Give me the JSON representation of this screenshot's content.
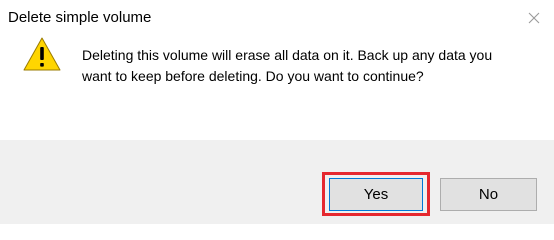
{
  "window": {
    "title": "Delete simple volume",
    "close_icon": "close-icon"
  },
  "message": {
    "icon": "warning-icon",
    "text": "Deleting this volume will erase all data on it. Back up any data you want to keep before deleting. Do you want to continue?"
  },
  "buttons": {
    "yes_label": "Yes",
    "no_label": "No"
  },
  "highlight": {
    "target": "yes-button",
    "color": "#e5282f"
  },
  "colors": {
    "footer_bg": "#f0f0f0",
    "focus_border": "#0078d7",
    "warning_fill": "#ffd500"
  }
}
